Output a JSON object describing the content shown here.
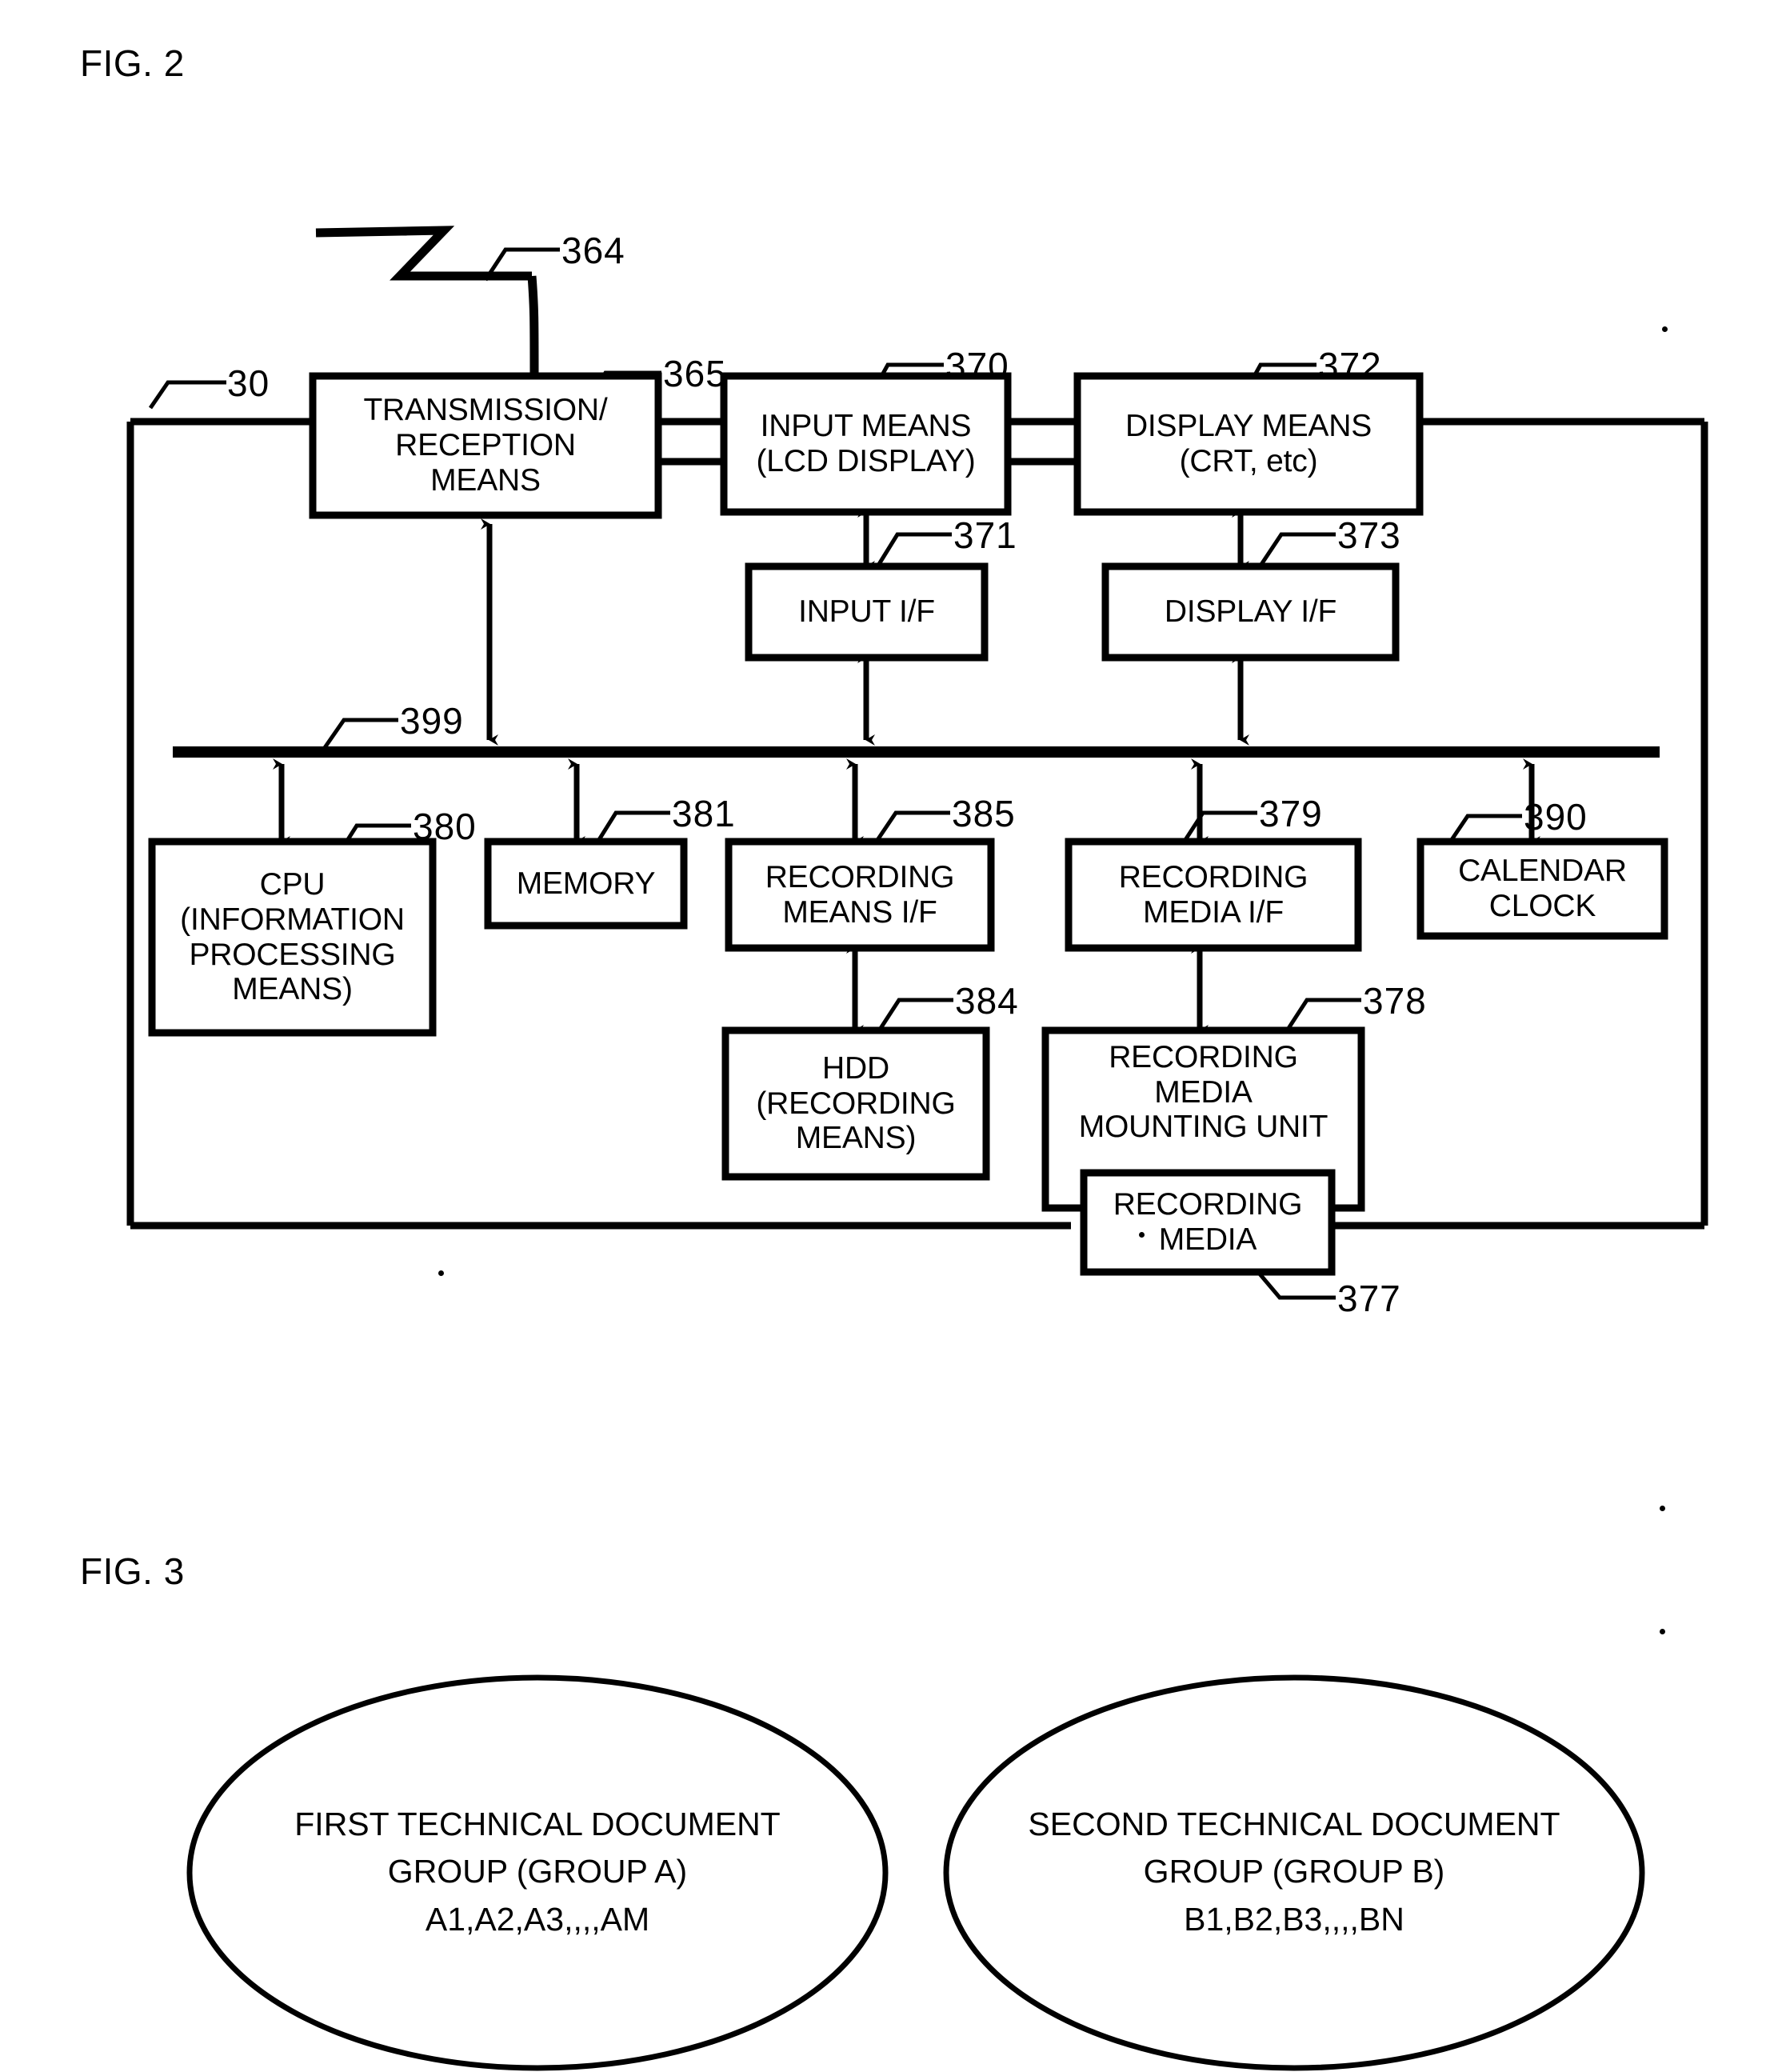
{
  "figures": {
    "fig2": {
      "label": "FIG. 2"
    },
    "fig3": {
      "label": "FIG. 3"
    }
  },
  "refs": {
    "r30": "30",
    "r364": "364",
    "r365": "365",
    "r370": "370",
    "r371": "371",
    "r372": "372",
    "r373": "373",
    "r377": "377",
    "r378": "378",
    "r379": "379",
    "r380": "380",
    "r381": "381",
    "r384": "384",
    "r385": "385",
    "r390": "390",
    "r399": "399"
  },
  "blocks": {
    "transmission_reception": "TRANSMISSION/\nRECEPTION\nMEANS",
    "input_means": "INPUT MEANS\n(LCD DISPLAY)",
    "display_means": "DISPLAY MEANS\n(CRT, etc)",
    "input_if": "INPUT I/F",
    "display_if": "DISPLAY I/F",
    "cpu": "CPU\n(INFORMATION\nPROCESSING\nMEANS)",
    "memory": "MEMORY",
    "recording_means_if": "RECORDING\nMEANS I/F",
    "recording_media_if": "RECORDING\nMEDIA I/F",
    "calendar_clock": "CALENDAR\nCLOCK",
    "hdd": "HDD\n(RECORDING\nMEANS)",
    "recording_media_mounting_unit": "RECORDING\nMEDIA\nMOUNTING UNIT",
    "recording_media": "RECORDING\nMEDIA"
  },
  "fig3": {
    "group_a": {
      "line1": "FIRST TECHNICAL DOCUMENT",
      "line2": "GROUP (GROUP A)",
      "line3": "A1,A2,A3,,,,AM"
    },
    "group_b": {
      "line1": "SECOND TECHNICAL DOCUMENT",
      "line2": "GROUP (GROUP B)",
      "line3": "B1,B2,B3,,,,BN"
    }
  },
  "colors": {
    "ink": "#000000",
    "paper": "#ffffff"
  }
}
